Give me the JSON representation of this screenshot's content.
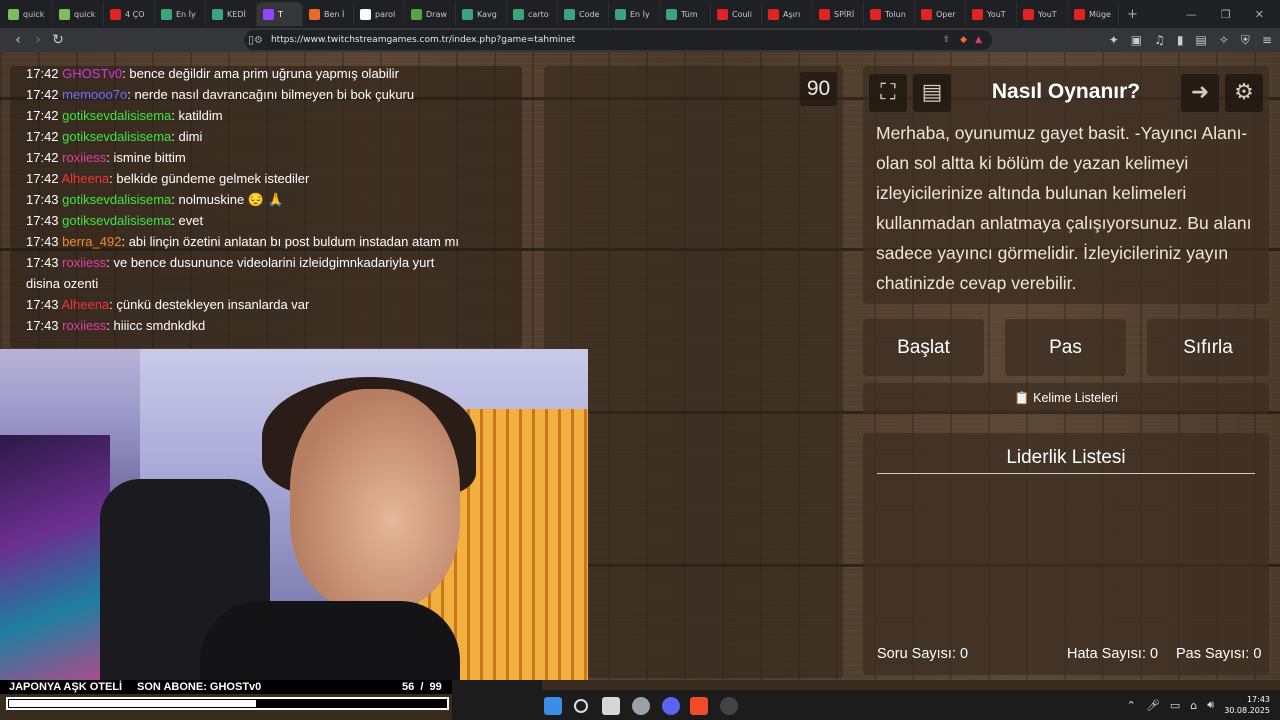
{
  "browser": {
    "tabs": [
      {
        "label": "quick",
        "color": "#7bbf5a"
      },
      {
        "label": "quick",
        "color": "#7bbf5a"
      },
      {
        "label": "4 ÇO",
        "color": "#e02424"
      },
      {
        "label": "En İy",
        "color": "#3aa57a"
      },
      {
        "label": "KEDİ",
        "color": "#3aa57a"
      },
      {
        "label": "T",
        "color": "#9147ff",
        "active": true
      },
      {
        "label": "Ben İ",
        "color": "#e86b2a"
      },
      {
        "label": "parol",
        "color": "#ffffff"
      },
      {
        "label": "Draw",
        "color": "#55a544"
      },
      {
        "label": "Kavg",
        "color": "#3aa57a"
      },
      {
        "label": "carto",
        "color": "#3aa57a"
      },
      {
        "label": "Code",
        "color": "#3aa57a"
      },
      {
        "label": "En İy",
        "color": "#3aa57a"
      },
      {
        "label": "Tüm",
        "color": "#3aa57a"
      },
      {
        "label": "Couli",
        "color": "#e02424"
      },
      {
        "label": "Aşırı",
        "color": "#e02424"
      },
      {
        "label": "SPİRİ",
        "color": "#e02424"
      },
      {
        "label": "Tolun",
        "color": "#e02424"
      },
      {
        "label": "Oper",
        "color": "#e02424"
      },
      {
        "label": "YouT",
        "color": "#e02424"
      },
      {
        "label": "YouT",
        "color": "#e02424"
      },
      {
        "label": "Müge",
        "color": "#e02424"
      }
    ],
    "new_tab": "+",
    "url": "https://www.twitchstreamgames.com.tr/index.php?game=tahminet"
  },
  "chat": [
    {
      "time": "17:42",
      "user": "GHOSTv0",
      "user_color": "#d238d8",
      "text": "bence değildir ama prim uğruna yapmış olabilir"
    },
    {
      "time": "17:42",
      "user": "memooo7o",
      "user_color": "#6f6fff",
      "text": "nerde nasıl davrancağını bilmeyen bi bok çukuru"
    },
    {
      "time": "17:42",
      "user": "gotiksevdalisisema",
      "user_color": "#3fe63f",
      "text": "katildim"
    },
    {
      "time": "17:42",
      "user": "gotiksevdalisisema",
      "user_color": "#3fe63f",
      "text": "dimi"
    },
    {
      "time": "17:42",
      "user": "roxiiess",
      "user_color": "#e23fa6",
      "text": "ismine bittim"
    },
    {
      "time": "17:42",
      "user": "Alheena",
      "user_color": "#f03434",
      "text": "belkide gündeme gelmek istediler"
    },
    {
      "time": "17:43",
      "user": "gotiksevdalisisema",
      "user_color": "#3fe63f",
      "text": "nolmuskine 😔 🙏"
    },
    {
      "time": "17:43",
      "user": "gotiksevdalisisema",
      "user_color": "#3fe63f",
      "text": "evet"
    },
    {
      "time": "17:43",
      "user": "berra_492",
      "user_color": "#f08a30",
      "text": "abi linçin özetini anlatan bı post buldum instadan atam mı"
    },
    {
      "time": "17:43",
      "user": "roxiiess",
      "user_color": "#e23fa6",
      "text": "ve bence dusununce videolarini izleidgimnkadariyla yurt"
    },
    {
      "time": "",
      "user": "",
      "user_color": "#ffffff",
      "text": "disina ozenti"
    },
    {
      "time": "17:43",
      "user": "Alheena",
      "user_color": "#f03434",
      "text": "çünkü destekleyen insanlarda var"
    },
    {
      "time": "17:43",
      "user": "roxiiess",
      "user_color": "#e23fa6",
      "text": "hiiicc smdnkdkd"
    }
  ],
  "game": {
    "timer": "90",
    "howto_title": "Nasıl Oynanır?",
    "howto_text": "Merhaba, oyunumuz gayet basit. -Yayıncı Alanı- olan sol altta ki bölüm de yazan kelimeyi izleyicilerinize altında bulunan kelimeleri kullanmadan anlatmaya çalışıyorsunuz. Bu alanı sadece yayıncı görmelidir. İzleyicileriniz yayın chatinizde cevap verebilir.",
    "buttons": {
      "start": "Başlat",
      "pass": "Pas",
      "reset": "Sıfırla"
    },
    "word_lists": "📋 Kelime Listeleri",
    "leaderboard_title": "Liderlik Listesi",
    "stats": {
      "questions_label": "Soru Sayısı:",
      "questions": "0",
      "errors_label": "Hata Sayısı:",
      "errors": "0",
      "passes_label": "Pas Sayısı:",
      "passes": "0"
    }
  },
  "stream_overlay": {
    "title": "JAPONYA AŞK OTELİ",
    "last_sub": "SON ABONE: GHOSTv0",
    "progress_text": "56  /  99",
    "progress_current": 56,
    "progress_total": 99
  },
  "taskbar": {
    "time": "17:43",
    "date": "30.08.2025"
  }
}
